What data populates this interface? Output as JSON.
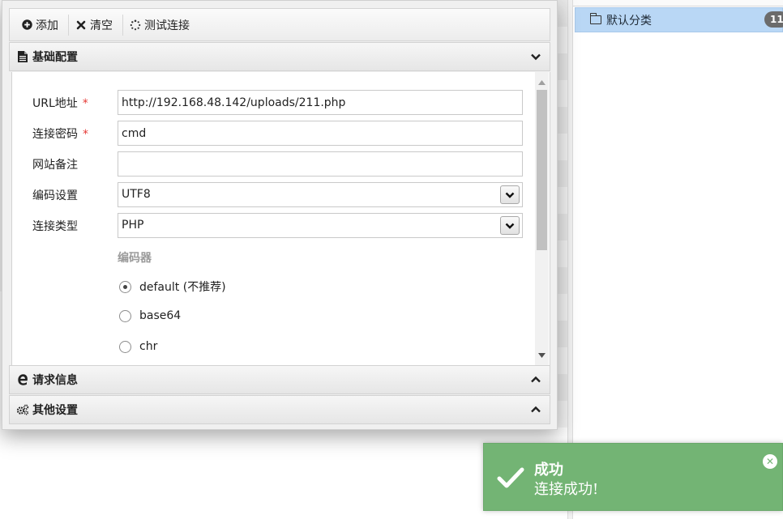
{
  "toolbar": {
    "add_label": "添加",
    "clear_label": "清空",
    "test_label": "测试连接"
  },
  "sections": {
    "basic": "基础配置",
    "request": "请求信息",
    "other": "其他设置"
  },
  "form": {
    "url_label": "URL地址",
    "url_value": "http://192.168.48.142/uploads/211.php",
    "password_label": "连接密码",
    "password_value": "cmd",
    "note_label": "网站备注",
    "note_value": "",
    "encoding_label": "编码设置",
    "encoding_value": "UTF8",
    "type_label": "连接类型",
    "type_value": "PHP",
    "required_mark": "*",
    "encoder_title": "编码器",
    "encoders": [
      {
        "label": "default (不推荐)",
        "checked": true
      },
      {
        "label": "base64",
        "checked": false
      },
      {
        "label": "chr",
        "checked": false
      }
    ]
  },
  "category": {
    "name": "默认分类",
    "count": "11"
  },
  "toast": {
    "title": "成功",
    "message": "连接成功!",
    "color": "#73b474"
  }
}
